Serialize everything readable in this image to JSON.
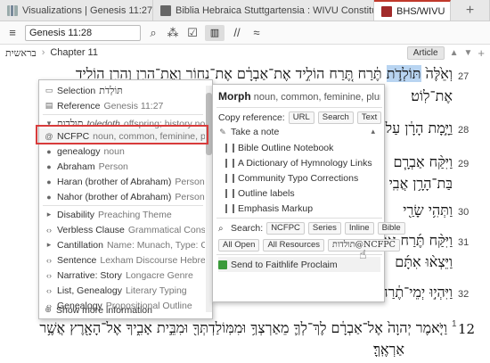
{
  "tabs": [
    {
      "label": "Visualizations | Genesis 11:27–32",
      "icon": "chart-icon"
    },
    {
      "label": "Biblia Hebraica Stuttgartensia : WIVU Constituency Trees",
      "icon": "book-icon"
    },
    {
      "label": "BHS/WIVU",
      "icon": "bhs-icon"
    }
  ],
  "add_tab": "+",
  "toolbar": {
    "menu_glyph": "≡",
    "reference": "Genesis 11:28",
    "search_glyph": "⌕",
    "tools_glyph": "⁂",
    "check_glyph": "☑",
    "layout_glyph": "▥",
    "parallel_glyph": "//",
    "approx_glyph": "≈"
  },
  "header": {
    "book_hebrew": "בראשית",
    "chapter": "Chapter 11",
    "article": "Article",
    "up_glyph": "▲",
    "down_glyph": "▼",
    "add_glyph": "+"
  },
  "verses": [
    {
      "num": "27",
      "lines": [
        "וְאֵ֙לֶּה֙ תּוֹלְדֹ֣ת תֶּ֔רַח תֶּ֚רַח הוֹלִ֣יד אֶת־אַבְרָ֔ם אֶת־נָח֖וֹר וְאֶת־הָרָ֑ן וְהָרָ֖ן הוֹלִ֥יד",
        "אֶת־לֽוֹט׃"
      ]
    },
    {
      "num": "28",
      "lines": [
        "וַיָּ֣מָת הָרָ֔ן עַל־פְּנֵ֖י"
      ]
    },
    {
      "num": "29",
      "lines": [
        "וַיִּקַּ֨ח אַבְרָ֧ם",
        "בַּת־הָרָ֥ן אֲבִֽי"
      ]
    },
    {
      "num": "30",
      "lines": [
        "וַתְּהִ֥י שָׂרַ֖י"
      ]
    },
    {
      "num": "31",
      "lines": [
        "וַיִּקַּ֨ח תֶּ֜רַח אֶת־",
        "וַיֵּצְא֨וּ אִתָּ֜ם"
      ]
    },
    {
      "num": "32",
      "lines": [
        "וַיִּהְי֣וּ יְמֵי־תֶ֔רַח"
      ]
    },
    {
      "num": "12",
      "sub": "1",
      "lines": [
        "וַיֹּ֤אמֶר יְהוָה֙ אֶל־אַבְרָ֔ם לֶךְ־לְךָ֛ מֵאַרְצְךָ֥ וּמִמּֽוֹלַדְתְּךָ֖ וּמִבֵּ֣ית אָבִ֑יךָ אֶל־הָאָ֖רֶץ אֲשֶׁ֥ר",
        "אַרְאֶֽךָּ׃"
      ]
    }
  ],
  "left_popup": {
    "items": [
      {
        "icon": "selection-icon",
        "label": "Selection",
        "hebrew": "תּוֹלְדֹת"
      },
      {
        "icon": "reference-icon",
        "label": "Reference",
        "extra": "Genesis 11:27"
      },
      {
        "icon": "caret-down-icon",
        "hebrew": "תולדות",
        "italic": "toledoth",
        "extra": "offspring; history noun"
      },
      {
        "icon": "at-icon",
        "label": "NCFPC",
        "extra": "noun, common, feminine, plural,…",
        "more": "▸"
      },
      {
        "icon": "person-icon",
        "label": "genealogy",
        "extra": "noun"
      },
      {
        "icon": "person-icon",
        "label": "Abraham",
        "extra": "Person"
      },
      {
        "icon": "person-icon",
        "label": "Haran (brother of Abraham)",
        "extra": "Person"
      },
      {
        "icon": "person-icon",
        "label": "Nahor (brother of Abraham)",
        "extra": "Person"
      },
      {
        "icon": "caret-right-icon",
        "label": "Disability",
        "extra": "Preaching Theme"
      },
      {
        "icon": "code-icon",
        "label": "Verbless Clause",
        "extra": "Grammatical Constructions"
      },
      {
        "icon": "caret-right-icon",
        "label": "Cantillation",
        "extra": "Name: Munach, Type: Conjun…"
      },
      {
        "icon": "code-icon",
        "label": "Sentence",
        "extra": "Lexham Discourse Hebrew Bible"
      },
      {
        "icon": "code-icon",
        "label": "Narrative: Story",
        "extra": "Longacre Genre"
      },
      {
        "icon": "code-icon",
        "label": "List, Genealogy",
        "extra": "Literary Typing"
      },
      {
        "icon": "code-icon",
        "label": "Genealogy",
        "extra": "Propositional Outline"
      },
      {
        "icon": "plus-circle-icon",
        "label": "Show more information"
      }
    ]
  },
  "right_popup": {
    "title_bold": "Morph",
    "title_rest": "noun, common, feminine, plural, co",
    "copy_label": "Copy reference:",
    "copy_buttons": [
      "URL",
      "Search",
      "Text"
    ],
    "take_note": "Take a note",
    "notes": [
      "Bible Outline Notebook",
      "A Dictionary of Hymnology Links",
      "Community Typo Corrections",
      "Outline labels",
      "Emphasis Markup"
    ],
    "search_label": "Search:",
    "search_buttons": [
      "NCFPC",
      "Series",
      "Inline",
      "Bible"
    ],
    "search_buttons2": [
      "All Open",
      "All Resources",
      "תולדות@NCFPC"
    ],
    "send": "Send to Faithlife Proclaim"
  }
}
